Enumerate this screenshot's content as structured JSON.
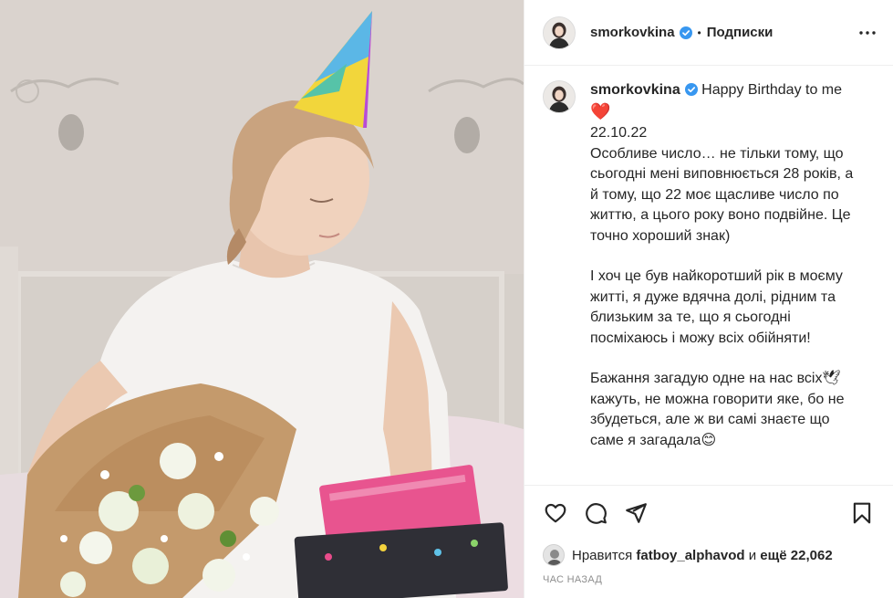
{
  "post": {
    "author": {
      "username": "smorkovkina",
      "verified": true
    },
    "follow_label": "Подписки",
    "dot": "•",
    "caption": {
      "username": "smorkovkina",
      "first_line": "Happy Birthday to me",
      "heart": "❤️",
      "date": "22.10.22",
      "para1": "Особливе число… не тільки тому, що сьогодні мені виповнюється 28 років, а й тому, що 22 моє щасливе число по життю, а цього року воно подвійне. Це точно хороший знак)",
      "para2": "І хоч це був найкоротший рік в моєму житті, я дуже вдячна долі, рідним та близьким за те, що я сьогодні посміхаюсь і можу всіх обійняти!",
      "para3": "Бажання загадую одне на нас всіх🕊 кажуть, не можна говорити яке, бо не збудеться, але ж ви самі знаєте що саме я загадала😊"
    },
    "likes": {
      "prefix": "Нравится",
      "user": "fatboy_alphavod",
      "and": "и",
      "more": "ещё 22,062"
    },
    "time_ago": "ЧАС НАЗАД",
    "icons": {
      "like": "heart-outline-icon",
      "comment": "comment-icon",
      "share": "share-plane-icon",
      "save": "bookmark-icon",
      "more": "more-dots-icon",
      "verified": "verified-badge-icon"
    },
    "colors": {
      "verified": "#3897f0",
      "text": "#262626",
      "muted": "#8e8e8e",
      "divider": "#efefef"
    }
  }
}
